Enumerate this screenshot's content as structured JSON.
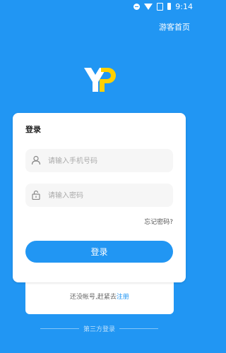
{
  "status_bar": {
    "time": "9:14"
  },
  "header": {
    "guest_link": "游客首页"
  },
  "login_card": {
    "title": "登录",
    "phone_placeholder": "请输入手机号码",
    "password_placeholder": "请输入密码",
    "forgot_password": "忘记密码?",
    "login_button": "登录"
  },
  "register": {
    "prompt": "还没帐号,赶紧去",
    "link": "注册"
  },
  "third_party": {
    "label": "第三方登录"
  },
  "colors": {
    "primary": "#2196F3",
    "logo_accent": "#FFD000",
    "background": "#2196F3"
  },
  "icons": {
    "status": [
      "dnd-icon",
      "wifi-icon",
      "no-sim-icon",
      "battery-icon"
    ],
    "phone_field": "user-icon",
    "password_field": "lock-icon"
  }
}
